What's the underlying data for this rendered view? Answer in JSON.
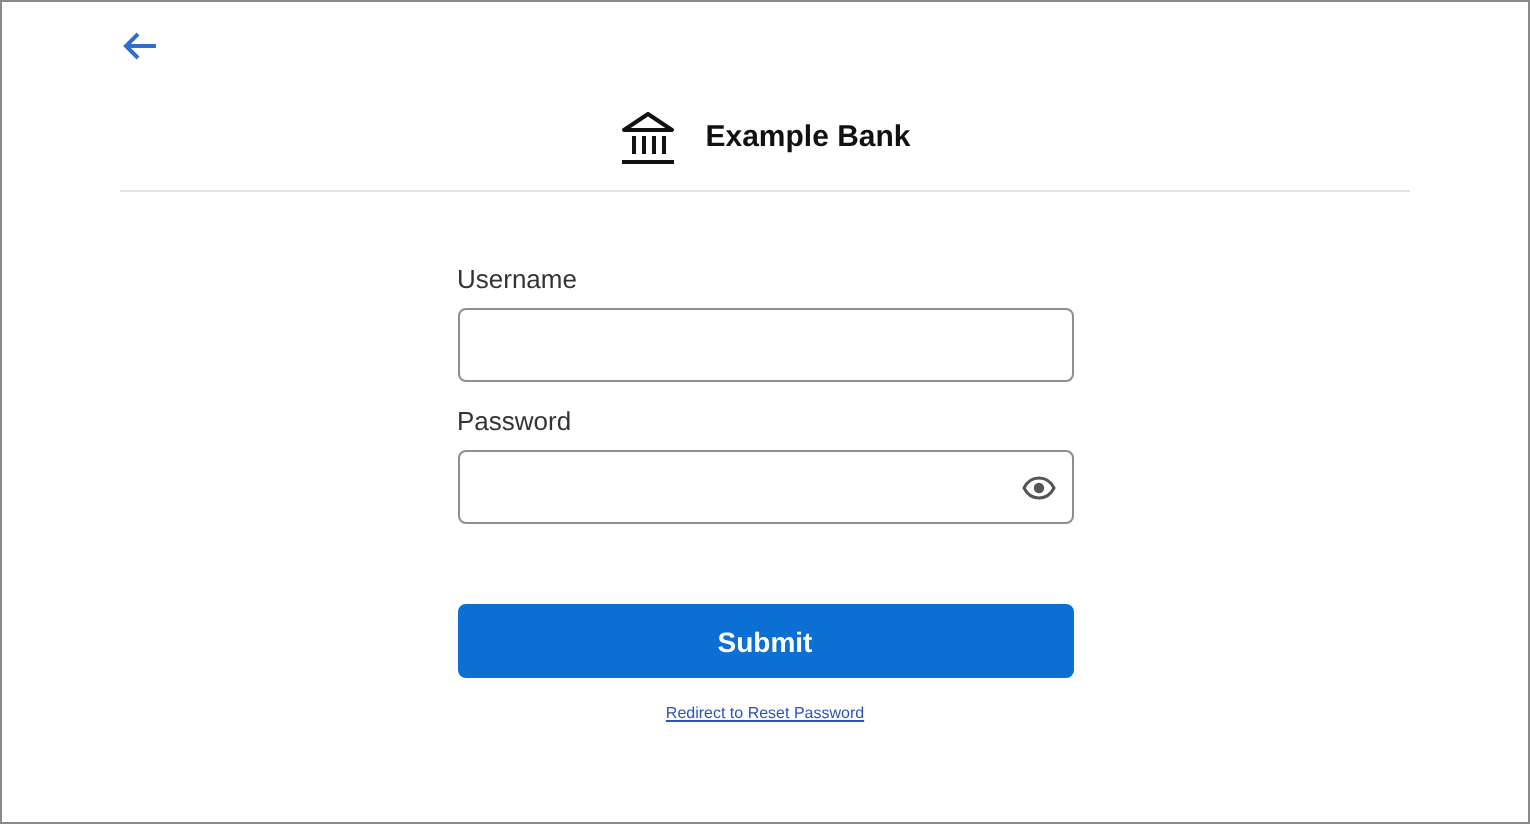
{
  "header": {
    "title": "Example Bank"
  },
  "form": {
    "fields": [
      {
        "label": "Username",
        "kind": "text"
      },
      {
        "label": "Password",
        "kind": "password"
      }
    ],
    "submit": "Submit",
    "link": "Redirect to Reset Password"
  }
}
